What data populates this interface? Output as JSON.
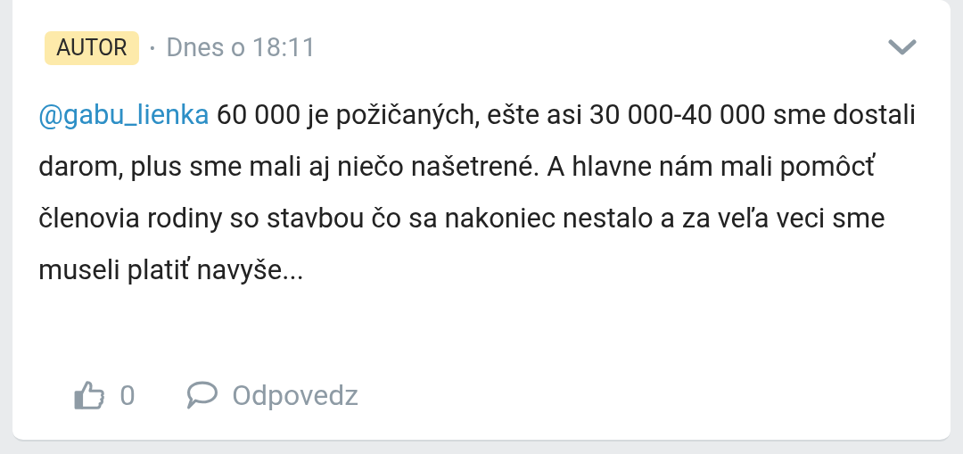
{
  "comment": {
    "badge": "AUTOR",
    "separator": "•",
    "time": "Dnes o 18:11",
    "mention": "@gabu_lienka",
    "text": " 60 000 je požičaných, ešte asi 30 000-40 000 sme dostali darom, plus sme mali aj niečo našetrené. A hlavne nám mali pomôcť členovia rodiny so stavbou čo sa nakoniec nestalo a za veľa veci sme museli platiť navyše...",
    "likes": "0",
    "reply": "Odpovedz"
  }
}
